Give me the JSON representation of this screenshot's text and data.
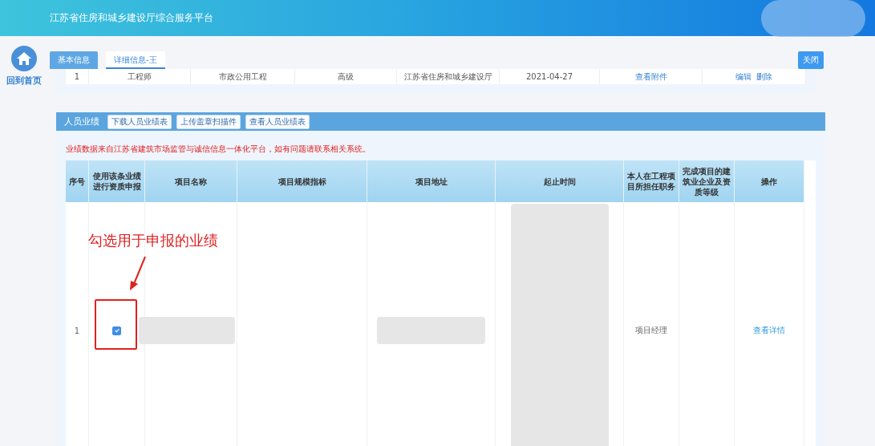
{
  "header": {
    "title": "江苏省住房和城乡建设厅综合服务平台"
  },
  "sidebar": {
    "home_label": "回到首页"
  },
  "tabs": [
    {
      "label": "基本信息",
      "selected": false
    },
    {
      "label": "详细信息-王",
      "selected": true
    }
  ],
  "close_button": "关闭",
  "upper_table": {
    "rows": [
      {
        "cells": [
          "1",
          "工程师",
          "市政公用工程",
          "高级",
          "江苏省住房和城乡建设厅",
          "2021-04-27"
        ],
        "link": "查看附件",
        "actions": [
          "编辑",
          "删除"
        ]
      }
    ]
  },
  "performance": {
    "title": "人员业绩",
    "buttons": [
      "下载人员业绩表",
      "上传盖章扫描件",
      "查看人员业绩表"
    ],
    "notice": "业绩数据来自江苏省建筑市场监管与诚信信息一体化平台，如有问题请联系相关系统。",
    "columns": [
      "序号",
      "使用该条业绩进行资质申报",
      "项目名称",
      "项目规模指标",
      "项目地址",
      "起止时间",
      "本人在工程项目所担任职务",
      "完成项目的建筑业企业及资质等级",
      "操作"
    ],
    "rows": [
      {
        "index": "1",
        "checked": true,
        "position": "项目经理",
        "action": "查看详情"
      }
    ]
  },
  "annotation": {
    "text": "勾选用于申报的业绩"
  }
}
